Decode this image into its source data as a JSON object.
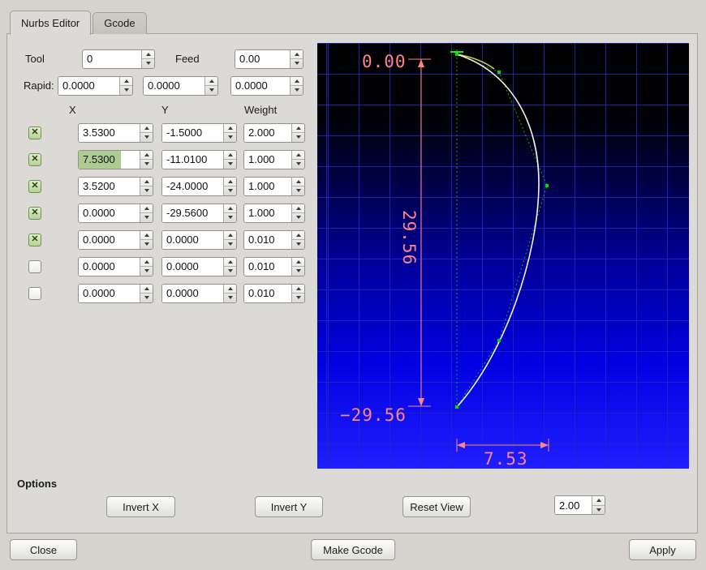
{
  "tabs": {
    "nurbs": "Nurbs Editor",
    "gcode": "Gcode"
  },
  "params": {
    "tool_label": "Tool",
    "tool_value": "0",
    "feed_label": "Feed",
    "feed_value": "0.00",
    "rapid_label": "Rapid:",
    "rapid1": "0.0000",
    "rapid2": "0.0000",
    "rapid3": "0.0000"
  },
  "table": {
    "header_x": "X",
    "header_y": "Y",
    "header_weight": "Weight",
    "rows": [
      {
        "checked": true,
        "x": "3.5300",
        "y": "-1.5000",
        "w": "2.000",
        "x_selected": false
      },
      {
        "checked": true,
        "x": "7.5300",
        "y": "-11.0100",
        "w": "1.000",
        "x_selected": true
      },
      {
        "checked": true,
        "x": "3.5200",
        "y": "-24.0000",
        "w": "1.000",
        "x_selected": false
      },
      {
        "checked": true,
        "x": "0.0000",
        "y": "-29.5600",
        "w": "1.000",
        "x_selected": false
      },
      {
        "checked": true,
        "x": "0.0000",
        "y": "0.0000",
        "w": "0.010",
        "x_selected": false
      },
      {
        "checked": false,
        "x": "0.0000",
        "y": "0.0000",
        "w": "0.010",
        "x_selected": false
      },
      {
        "checked": false,
        "x": "0.0000",
        "y": "0.0000",
        "w": "0.010",
        "x_selected": false
      }
    ]
  },
  "plot": {
    "dim_zero": "0.00",
    "dim_height": "29.56",
    "dim_bottom": "−29.56",
    "dim_width": "7.53",
    "colors": {
      "dimension": "#ff8585",
      "curve": "#f2f2e6",
      "control_polygon": "#00b400",
      "grid": "#2626be"
    }
  },
  "options": {
    "label": "Options",
    "invert_x": "Invert X",
    "invert_y": "Invert Y",
    "reset_view": "Reset View",
    "scale_value": "2.00"
  },
  "footer": {
    "close": "Close",
    "make_gcode": "Make Gcode",
    "apply": "Apply"
  }
}
